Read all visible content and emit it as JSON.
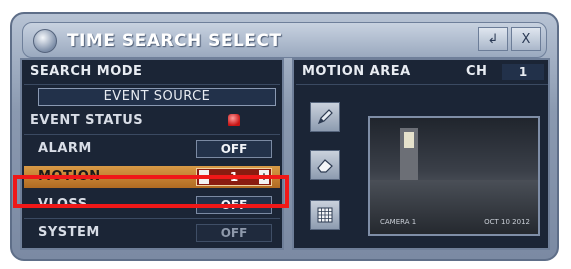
{
  "window": {
    "title": "TIME SEARCH SELECT",
    "enter_button": "↲",
    "close_button": "X"
  },
  "search_mode": {
    "header": "SEARCH MODE",
    "source_button": "EVENT SOURCE",
    "status_header": "EVENT STATUS",
    "rows": [
      {
        "label": "ALARM",
        "value": "OFF"
      },
      {
        "label": "MOTION",
        "value": "1"
      },
      {
        "label": "VLOSS",
        "value": "OFF"
      },
      {
        "label": "SYSTEM",
        "value": "OFF"
      }
    ]
  },
  "motion_area": {
    "header": "MOTION AREA",
    "ch_label": "CH",
    "ch_value": "1",
    "tools": [
      "pen-icon",
      "eraser-icon",
      "grid-icon"
    ],
    "preview_caption_left": "CAMERA 1",
    "preview_caption_right": "OCT 10 2012"
  },
  "colors": {
    "highlight": "#f01818",
    "selected_row": "#c07a2e",
    "panel_bg": "#1b2536"
  }
}
